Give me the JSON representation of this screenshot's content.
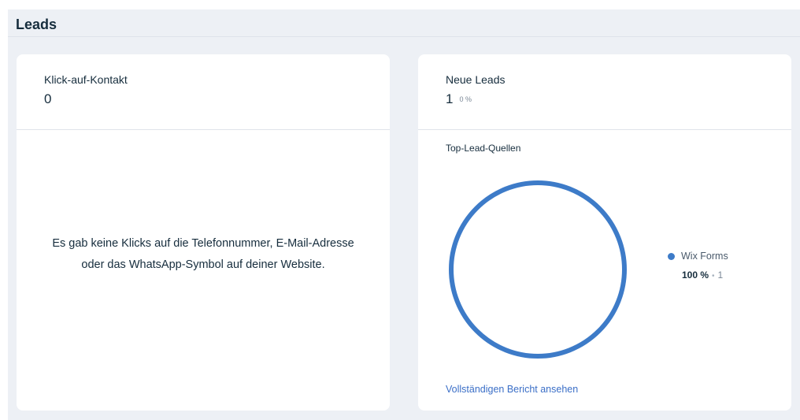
{
  "section": {
    "title": "Leads"
  },
  "click_card": {
    "label": "Klick-auf-Kontakt",
    "value": "0",
    "empty_message": "Es gab keine Klicks auf die Telefonnummer, E-Mail-Adresse oder das WhatsApp-Symbol auf deiner Website."
  },
  "leads_card": {
    "label": "Neue Leads",
    "value": "1",
    "change": "0 %",
    "sources_title": "Top-Lead-Quellen",
    "legend": [
      {
        "name": "Wix Forms",
        "percent": "100 %",
        "count": "1",
        "share": 1.0,
        "color": "#3d7bc8"
      }
    ],
    "report_link": "Vollständigen Bericht ansehen"
  }
}
